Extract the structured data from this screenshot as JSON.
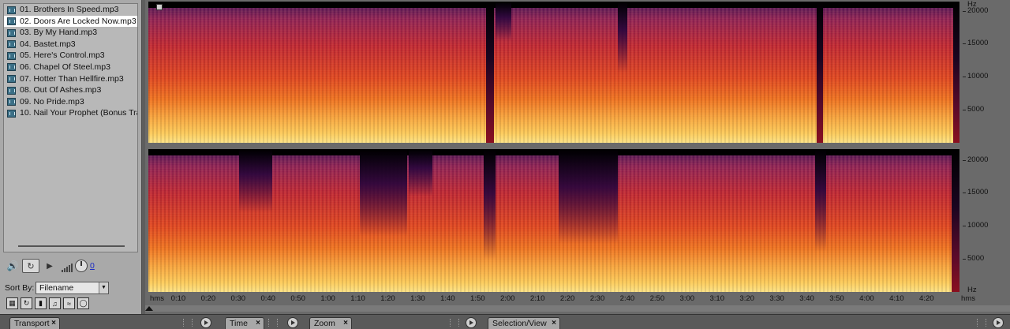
{
  "files_panel": {
    "files": [
      "01. Brothers In Speed.mp3",
      "02. Doors Are Locked Now.mp3",
      "03. By My Hand.mp3",
      "04. Bastet.mp3",
      "05. Here's Control.mp3",
      "06. Chapel Of Steel.mp3",
      "07. Hotter Than Hellfire.mp3",
      "08. Out Of Ashes.mp3",
      "09. No Pride.mp3",
      "10. Nail Your Prophet (Bonus Track).mp3"
    ],
    "selected_index": 1,
    "volume_value": "0",
    "sort_label": "Sort By:",
    "sort_value": "Filename",
    "icons": [
      "speaker-icon",
      "loop-icon",
      "play-icon",
      "volume-bars-icon",
      "volume-knob-icon"
    ]
  },
  "spectral": {
    "freq_unit": "Hz",
    "freq_labels": [
      "20000",
      "15000",
      "10000",
      "5000"
    ],
    "time_unit": "hms",
    "time_labels": [
      "0:10",
      "0:20",
      "0:30",
      "0:40",
      "0:50",
      "1:00",
      "1:10",
      "1:20",
      "1:30",
      "1:40",
      "1:50",
      "2:00",
      "2:10",
      "2:20",
      "2:30",
      "2:40",
      "2:50",
      "3:00",
      "3:10",
      "3:20",
      "3:30",
      "3:40",
      "3:50",
      "4:00",
      "4:10",
      "4:20"
    ],
    "track_duration": "4:31"
  },
  "tabs": [
    {
      "label": "Transport"
    },
    {
      "label": "Time"
    },
    {
      "label": "Zoom"
    },
    {
      "label": "Selection/View"
    }
  ],
  "colors": {
    "background": "#5d5d5d",
    "panel": "#a9a9a9",
    "selected_row": "#ffffff",
    "spectrum_low": "#fde489",
    "spectrum_mid": "#e04220",
    "spectrum_high": "#5a1457"
  }
}
